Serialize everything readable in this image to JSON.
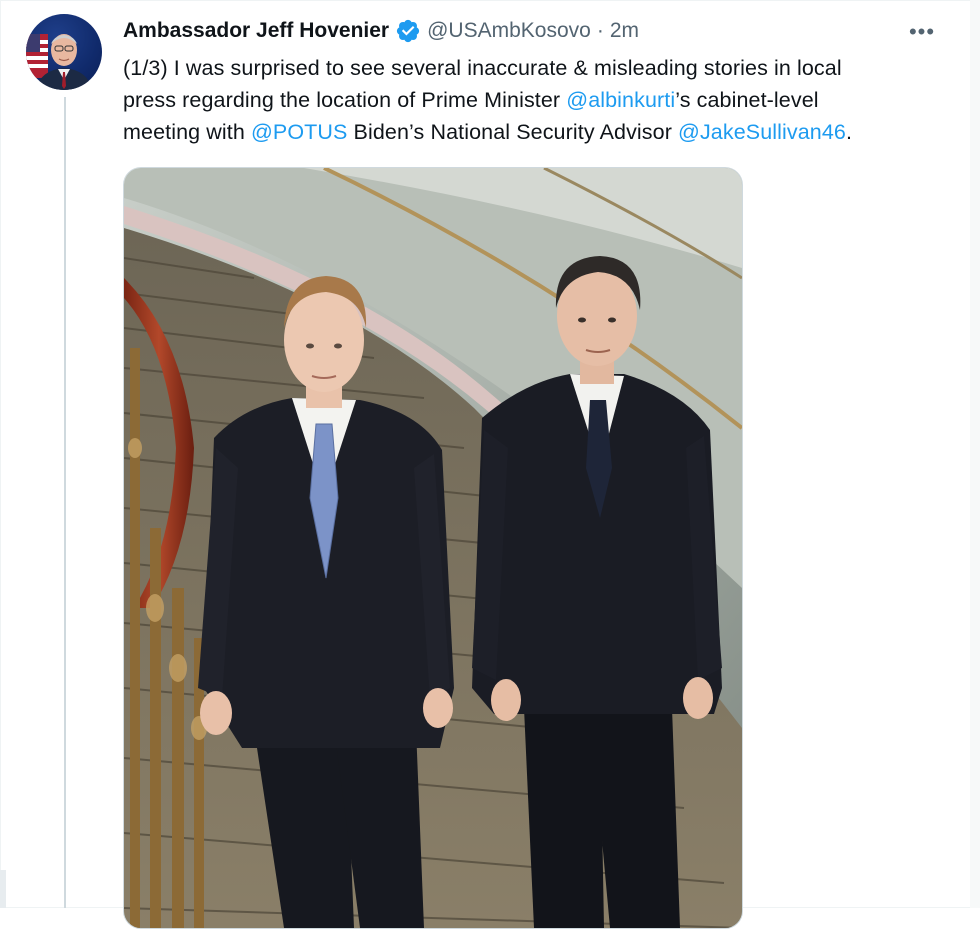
{
  "tweet": {
    "author_name": "Ambassador Jeff Hovenier",
    "handle": "@USAmbKosovo",
    "separator": "·",
    "time": "2m",
    "more_menu": "•••",
    "text_lines": [
      [
        {
          "t": "(1/3) I was surprised to see several inaccurate & misleading stories in local",
          "m": false
        }
      ],
      [
        {
          "t": "press regarding the location of Prime Minister ",
          "m": false
        },
        {
          "t": "@albinkurti",
          "m": true
        },
        {
          "t": "’s cabinet-level",
          "m": false
        }
      ],
      [
        {
          "t": "meeting with ",
          "m": false
        },
        {
          "t": "@POTUS",
          "m": true
        },
        {
          "t": " Biden’s National Security Advisor ",
          "m": false
        },
        {
          "t": "@JakeSullivan46",
          "m": true
        },
        {
          "t": ".",
          "m": false
        }
      ]
    ]
  },
  "colors": {
    "accent": "#1d9bf0",
    "text_primary": "#0f1419",
    "text_secondary": "#536471",
    "thread_line": "#cfd9de"
  },
  "icons": {
    "verified": "verified-badge-icon",
    "more": "more-horizontal-icon"
  }
}
